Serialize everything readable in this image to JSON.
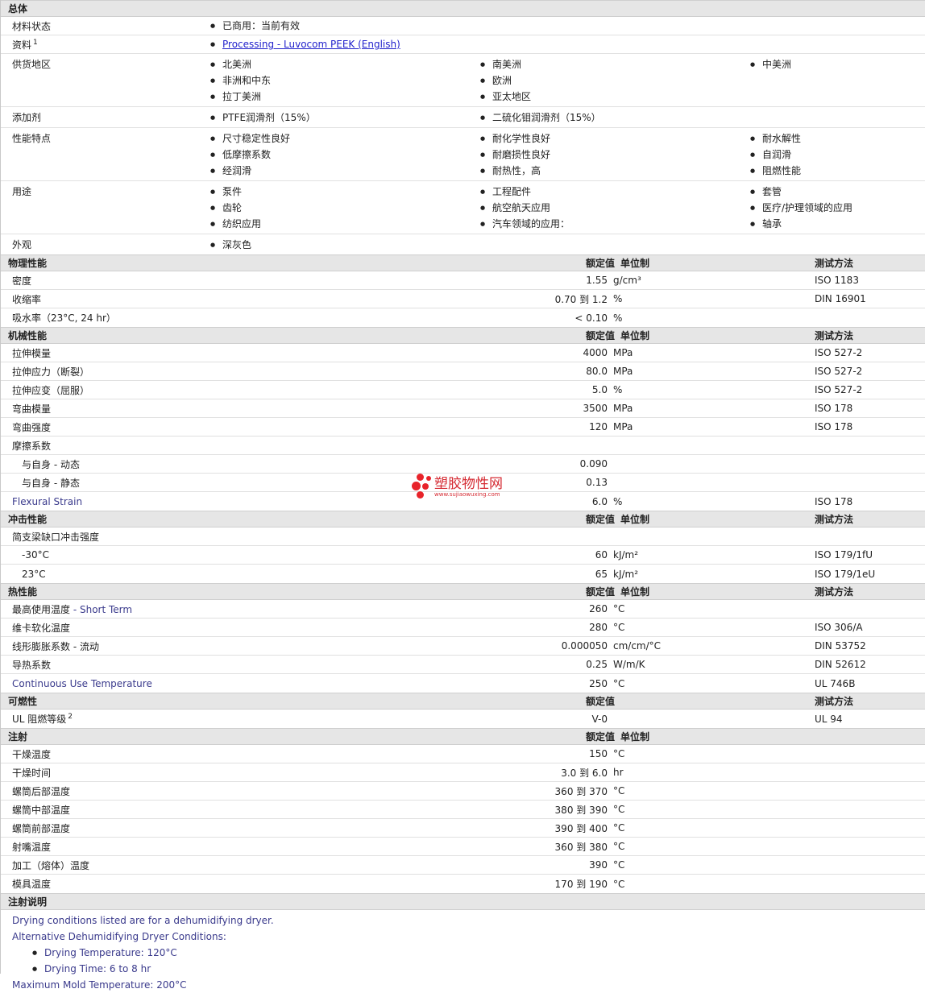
{
  "general": {
    "title": "总体",
    "material_status": {
      "label": "材料状态",
      "value": "已商用：当前有效"
    },
    "documents": {
      "label": "资料",
      "sup": "1",
      "value": "Processing - Luvocom PEEK (English)"
    },
    "regions": {
      "label": "供货地区",
      "cols": [
        [
          "北美洲",
          "非洲和中东",
          "拉丁美洲"
        ],
        [
          "南美洲",
          "欧洲",
          "亚太地区"
        ],
        [
          "中美洲"
        ]
      ]
    },
    "additives": {
      "label": "添加剂",
      "cols": [
        [
          "PTFE润滑剂（15%）"
        ],
        [
          "二硫化钼润滑剂（15%）"
        ]
      ]
    },
    "features": {
      "label": "性能特点",
      "cols": [
        [
          "尺寸稳定性良好",
          "低摩擦系数",
          "经润滑"
        ],
        [
          "耐化学性良好",
          "耐磨损性良好",
          "耐热性，高"
        ],
        [
          "耐水解性",
          "自润滑",
          "阻燃性能"
        ]
      ]
    },
    "uses": {
      "label": "用途",
      "cols": [
        [
          "泵件",
          "齿轮",
          "纺织应用"
        ],
        [
          "工程配件",
          "航空航天应用",
          "汽车领域的应用："
        ],
        [
          "套管",
          "医疗/护理领域的应用",
          "轴承"
        ]
      ]
    },
    "appearance": {
      "label": "外观",
      "cols": [
        [
          "深灰色"
        ]
      ]
    }
  },
  "headers": {
    "nominal": "额定值",
    "unit": "单位制",
    "method": "测试方法"
  },
  "physical": {
    "title": "物理性能",
    "rows": [
      {
        "name": "密度",
        "value": "1.55",
        "unit": "g/cm³",
        "method": "ISO 1183"
      },
      {
        "name": "收缩率",
        "value": "0.70 到  1.2",
        "unit": "%",
        "method": "DIN 16901"
      },
      {
        "name": "吸水率（23°C, 24 hr）",
        "value": "< 0.10",
        "unit": "%",
        "method": ""
      }
    ]
  },
  "mechanical": {
    "title": "机械性能",
    "rows": [
      {
        "name": "拉伸模量",
        "value": "4000",
        "unit": "MPa",
        "method": "ISO 527-2"
      },
      {
        "name": "拉伸应力（断裂）",
        "value": "80.0",
        "unit": "MPa",
        "method": "ISO 527-2"
      },
      {
        "name": "拉伸应变（屈服）",
        "value": "5.0",
        "unit": "%",
        "method": "ISO 527-2"
      },
      {
        "name": "弯曲模量",
        "value": "3500",
        "unit": "MPa",
        "method": "ISO 178"
      },
      {
        "name": "弯曲强度",
        "value": "120",
        "unit": "MPa",
        "method": "ISO 178"
      }
    ],
    "friction": {
      "name": "摩擦系数"
    },
    "friction_rows": [
      {
        "name": "与自身 - 动态",
        "value": "0.090",
        "unit": "",
        "method": ""
      },
      {
        "name": "与自身 - 静态",
        "value": "0.13",
        "unit": "",
        "method": ""
      }
    ],
    "flexural_strain": {
      "name": "Flexural Strain",
      "value": "6.0",
      "unit": "%",
      "method": "ISO 178"
    }
  },
  "impact": {
    "title": "冲击性能",
    "group": {
      "name": "简支梁缺口冲击强度"
    },
    "rows": [
      {
        "name": "-30°C",
        "value": "60",
        "unit": "kJ/m²",
        "method": "ISO 179/1fU"
      },
      {
        "name": "23°C",
        "value": "65",
        "unit": "kJ/m²",
        "method": "ISO 179/1eU"
      }
    ]
  },
  "thermal": {
    "title": "热性能",
    "rows": [
      {
        "name": "最高使用温度",
        "name_en": " - Short Term",
        "value": "260",
        "unit": "°C",
        "method": ""
      },
      {
        "name": "维卡软化温度",
        "name_en": "",
        "value": "280",
        "unit": "°C",
        "method": "ISO 306/A"
      },
      {
        "name": "线形膨胀系数 - 流动",
        "name_en": "",
        "value": "0.000050",
        "unit": "cm/cm/°C",
        "method": "DIN 53752"
      },
      {
        "name": "导热系数",
        "name_en": "",
        "value": "0.25",
        "unit": "W/m/K",
        "method": "DIN 52612"
      }
    ],
    "continuous": {
      "name": "Continuous Use Temperature",
      "value": "250",
      "unit": "°C",
      "method": "UL 746B"
    }
  },
  "flammability": {
    "title": "可燃性",
    "row": {
      "name": "UL 阻燃等级",
      "sup": "2",
      "value": "V-0",
      "method": "UL 94"
    }
  },
  "injection": {
    "title": "注射",
    "rows": [
      {
        "name": "干燥温度",
        "value": "150",
        "unit": "°C"
      },
      {
        "name": "干燥时间",
        "value": "3.0 到  6.0",
        "unit": "hr"
      },
      {
        "name": "螺筒后部温度",
        "value": "360 到  370",
        "unit": "°C"
      },
      {
        "name": "螺筒中部温度",
        "value": "380 到  390",
        "unit": "°C"
      },
      {
        "name": "螺筒前部温度",
        "value": "390 到  400",
        "unit": "°C"
      },
      {
        "name": "射嘴温度",
        "value": "360 到  380",
        "unit": "°C"
      },
      {
        "name": "加工（熔体）温度",
        "value": "390",
        "unit": "°C"
      },
      {
        "name": "模具温度",
        "value": "170 到  190",
        "unit": "°C"
      }
    ]
  },
  "notes": {
    "title": "注射说明",
    "line1": "Drying conditions listed are for a dehumidifying dryer.",
    "line2": "Alternative Dehumidifying Dryer Conditions:",
    "bullets": [
      "Drying Temperature: 120°C",
      "Drying Time: 6 to 8 hr"
    ],
    "line3": "Maximum Mold Temperature: 200°C"
  },
  "watermark": {
    "name": "塑胶物性网",
    "url": "www.sujiaowuxing.com"
  }
}
